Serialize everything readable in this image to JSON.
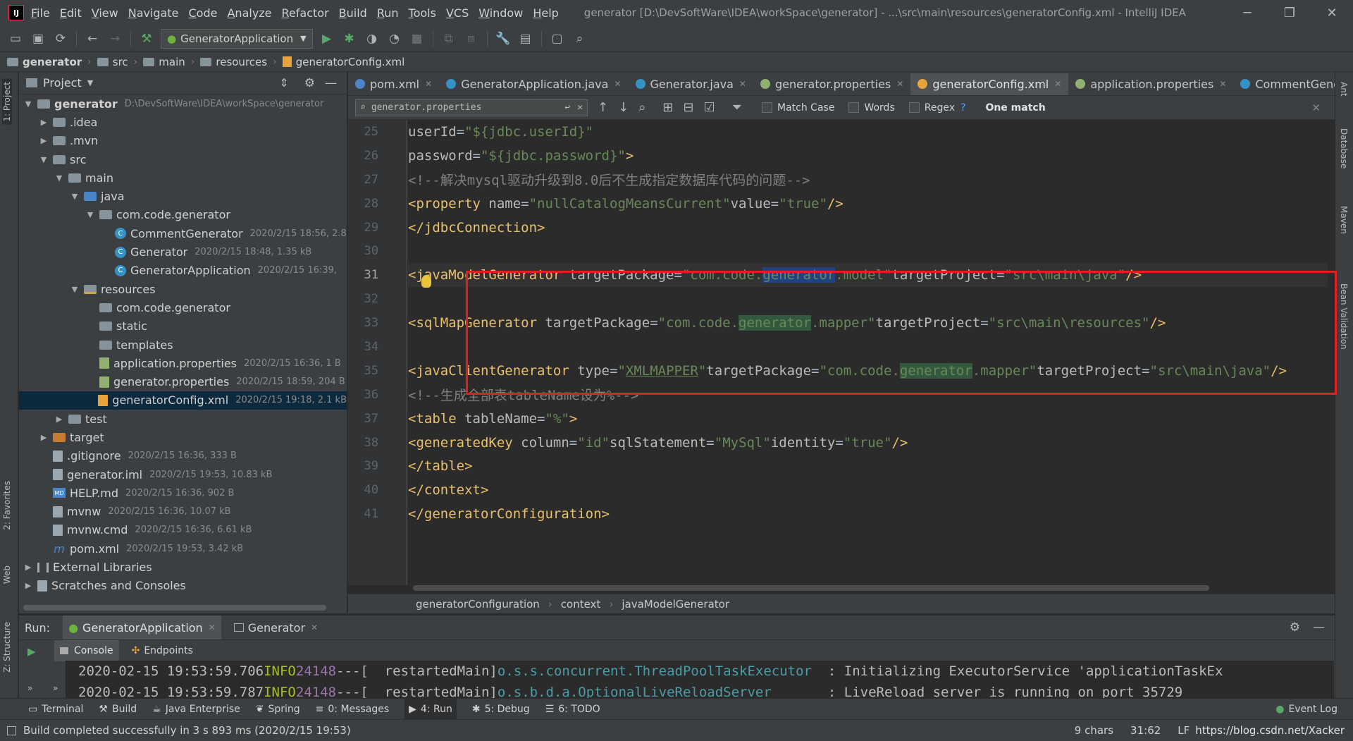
{
  "window": {
    "title": "generator [D:\\DevSoftWare\\IDEA\\workSpace\\generator] - ...\\src\\main\\resources\\generatorConfig.xml - IntelliJ IDEA",
    "logo_text": "IJ"
  },
  "menu": [
    "File",
    "Edit",
    "View",
    "Navigate",
    "Code",
    "Analyze",
    "Refactor",
    "Build",
    "Run",
    "Tools",
    "VCS",
    "Window",
    "Help"
  ],
  "toolbar": {
    "run_config": "GeneratorApplication"
  },
  "breadcrumb": [
    "generator",
    "src",
    "main",
    "resources",
    "generatorConfig.xml"
  ],
  "left_strip": {
    "project_tab": "1: Project",
    "favorites_tab": "2: Favorites",
    "web_tab": "Web",
    "structure_tab": "Z: Structure"
  },
  "right_strip": {
    "ant": "Ant",
    "database": "Database",
    "maven": "Maven",
    "bean_validation": "Bean Validation"
  },
  "project": {
    "title": "Project",
    "tree": [
      {
        "label": "generator",
        "meta": "D:\\DevSoftWare\\IDEA\\workSpace\\generator",
        "depth": 0,
        "arrow": "open",
        "icon": "folder",
        "bold": true
      },
      {
        "label": ".idea",
        "meta": "",
        "depth": 1,
        "arrow": "closed",
        "icon": "folder"
      },
      {
        "label": ".mvn",
        "meta": "",
        "depth": 1,
        "arrow": "closed",
        "icon": "folder"
      },
      {
        "label": "src",
        "meta": "",
        "depth": 1,
        "arrow": "open",
        "icon": "folder"
      },
      {
        "label": "main",
        "meta": "",
        "depth": 2,
        "arrow": "open",
        "icon": "folder"
      },
      {
        "label": "java",
        "meta": "",
        "depth": 3,
        "arrow": "open",
        "icon": "folder-blue"
      },
      {
        "label": "com.code.generator",
        "meta": "",
        "depth": 4,
        "arrow": "open",
        "icon": "folder"
      },
      {
        "label": "CommentGenerator",
        "meta": "2020/2/15 18:56, 2.8",
        "depth": 5,
        "arrow": "none",
        "icon": "class"
      },
      {
        "label": "Generator",
        "meta": "2020/2/15 18:48, 1.35 kB",
        "depth": 5,
        "arrow": "none",
        "icon": "class"
      },
      {
        "label": "GeneratorApplication",
        "meta": "2020/2/15 16:39,",
        "depth": 5,
        "arrow": "none",
        "icon": "class"
      },
      {
        "label": "resources",
        "meta": "",
        "depth": 3,
        "arrow": "open",
        "icon": "folder-res"
      },
      {
        "label": "com.code.generator",
        "meta": "",
        "depth": 4,
        "arrow": "none",
        "icon": "folder"
      },
      {
        "label": "static",
        "meta": "",
        "depth": 4,
        "arrow": "none",
        "icon": "folder"
      },
      {
        "label": "templates",
        "meta": "",
        "depth": 4,
        "arrow": "none",
        "icon": "folder"
      },
      {
        "label": "application.properties",
        "meta": "2020/2/15 16:36, 1 B",
        "depth": 4,
        "arrow": "none",
        "icon": "props"
      },
      {
        "label": "generator.properties",
        "meta": "2020/2/15 18:59, 204 B",
        "depth": 4,
        "arrow": "none",
        "icon": "props"
      },
      {
        "label": "generatorConfig.xml",
        "meta": "2020/2/15 19:18, 2.1 kB",
        "depth": 4,
        "arrow": "none",
        "icon": "xml",
        "selected": true
      },
      {
        "label": "test",
        "meta": "",
        "depth": 2,
        "arrow": "closed",
        "icon": "folder"
      },
      {
        "label": "target",
        "meta": "",
        "depth": 1,
        "arrow": "closed",
        "icon": "folder-orange"
      },
      {
        "label": ".gitignore",
        "meta": "2020/2/15 16:36, 333 B",
        "depth": 1,
        "arrow": "none",
        "icon": "file"
      },
      {
        "label": "generator.iml",
        "meta": "2020/2/15 19:53, 10.83 kB",
        "depth": 1,
        "arrow": "none",
        "icon": "file"
      },
      {
        "label": "HELP.md",
        "meta": "2020/2/15 16:36, 902 B",
        "depth": 1,
        "arrow": "none",
        "icon": "md"
      },
      {
        "label": "mvnw",
        "meta": "2020/2/15 16:36, 10.07 kB",
        "depth": 1,
        "arrow": "none",
        "icon": "file"
      },
      {
        "label": "mvnw.cmd",
        "meta": "2020/2/15 16:36, 6.61 kB",
        "depth": 1,
        "arrow": "none",
        "icon": "file"
      },
      {
        "label": "pom.xml",
        "meta": "2020/2/15 19:53, 3.42 kB",
        "depth": 1,
        "arrow": "none",
        "icon": "maven"
      },
      {
        "label": "External Libraries",
        "meta": "",
        "depth": 0,
        "arrow": "closed",
        "icon": "lib"
      },
      {
        "label": "Scratches and Consoles",
        "meta": "",
        "depth": 0,
        "arrow": "closed",
        "icon": "scratch"
      }
    ]
  },
  "tabs": [
    {
      "label": "pom.xml",
      "color": "#4a86c7",
      "closable": true
    },
    {
      "label": "GeneratorApplication.java",
      "color": "#3592c4",
      "closable": true
    },
    {
      "label": "Generator.java",
      "color": "#3592c4",
      "closable": true
    },
    {
      "label": "generator.properties",
      "color": "#8fb06e",
      "closable": true
    },
    {
      "label": "generatorConfig.xml",
      "color": "#e8a33c",
      "closable": true,
      "active": true
    },
    {
      "label": "application.properties",
      "color": "#8fb06e",
      "closable": true
    },
    {
      "label": "CommentGenera",
      "color": "#3592c4",
      "closable": false
    }
  ],
  "find": {
    "query": "generator.properties",
    "match_case": "Match Case",
    "words": "Words",
    "regex": "Regex",
    "regex_help": "?",
    "result": "One match"
  },
  "editor": {
    "line_numbers": [
      "25",
      "26",
      "27",
      "28",
      "29",
      "30",
      "31",
      "32",
      "33",
      "34",
      "35",
      "36",
      "37",
      "38",
      "39",
      "40",
      "41"
    ],
    "current_line": "31",
    "crumbs": [
      "generatorConfiguration",
      "context",
      "javaModelGenerator"
    ]
  },
  "run": {
    "label": "Run:",
    "tabs": [
      "GeneratorApplication",
      "Generator"
    ],
    "console_tab": "Console",
    "endpoints_tab": "Endpoints",
    "lines": [
      {
        "ts": "2020-02-15 19:53:59.706",
        "level": "INFO",
        "pid": "24148",
        "sep": "---",
        "thread": "[  restartedMain]",
        "logger": "o.s.s.concurrent.ThreadPoolTaskExecutor",
        "msg": "  : Initializing ExecutorService 'applicationTaskEx"
      },
      {
        "ts": "2020-02-15 19:53:59.787",
        "level": "INFO",
        "pid": "24148",
        "sep": "---",
        "thread": "[  restartedMain]",
        "logger": "o.s.b.d.a.OptionalLiveReloadServer",
        "msg": "       : LiveReload server is running on port 35729"
      }
    ]
  },
  "bottom_tabs": [
    {
      "label": "Terminal",
      "icon": "terminal"
    },
    {
      "label": "Build",
      "icon": "hammer"
    },
    {
      "label": "Java Enterprise",
      "icon": "jee"
    },
    {
      "label": "Spring",
      "icon": "leaf"
    },
    {
      "label": "0: Messages",
      "icon": "messages"
    },
    {
      "label": "4: Run",
      "icon": "play",
      "active": true
    },
    {
      "label": "5: Debug",
      "icon": "bug"
    },
    {
      "label": "6: TODO",
      "icon": "list"
    },
    {
      "label": "Event Log",
      "icon": "event"
    }
  ],
  "status": {
    "message": "Build completed successfully in 3 s 893 ms (2020/2/15 19:53)",
    "chars": "9 chars",
    "position": "31:62",
    "line_sep": "LF",
    "watermark": "https://blog.csdn.net/Xacker"
  }
}
